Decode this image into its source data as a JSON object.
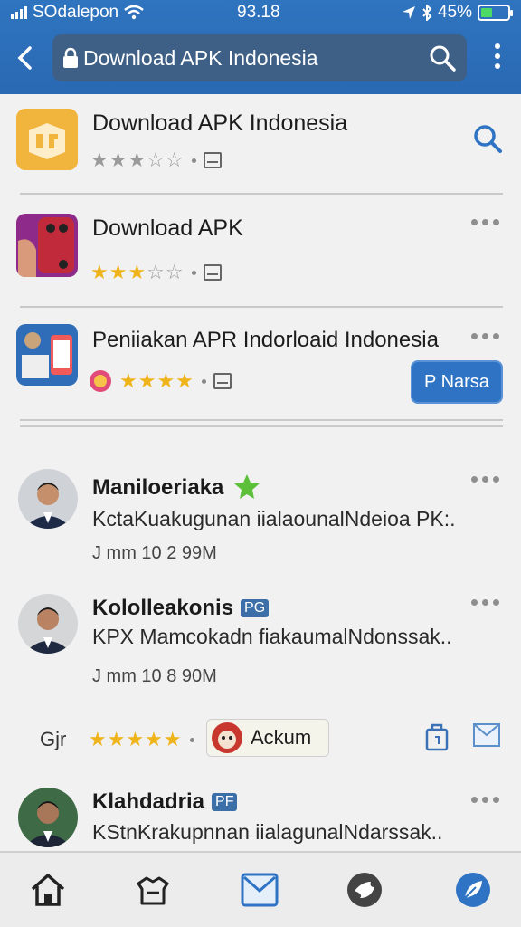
{
  "status": {
    "carrier": "SOdalepon",
    "time": "93.18",
    "battery": "45%"
  },
  "browser": {
    "url": "Download APK Indonesia"
  },
  "apps": [
    {
      "title": "Download APK Indonesia",
      "rating": 3,
      "rating_color": "grey"
    },
    {
      "title": "Download APK",
      "rating": 3,
      "rating_color": "gold"
    },
    {
      "title": "Peniiakan APR Indorloaid Indonesia",
      "rating": 4,
      "rating_color": "gold",
      "action_label": "P Narsa"
    }
  ],
  "posts": [
    {
      "name": "Maniloeriaka",
      "text": "KctaKuakugunan iialaounalNdeioa PK:.",
      "info": "J mm 10 2 99M"
    },
    {
      "name": "Kololleakonis",
      "badge": "PG",
      "text": "KPX Mamcokadn fiakaumalNdonssak..",
      "info": "J mm 10 8 90M"
    },
    {
      "name": "Klahdadria",
      "badge": "PF",
      "text": "KStnKrakupnnan iialagunalNdarssak.."
    }
  ],
  "action_row": {
    "prefix": "Gjr",
    "rating": 5,
    "chip_label": "Ackum"
  },
  "colors": {
    "accent": "#2f74c4",
    "star_gold": "#f0b41b",
    "header": "#2f74bf"
  },
  "icons": [
    "home-icon",
    "bag-icon",
    "mail-icon",
    "chat-bird-icon",
    "browser-leaf-icon"
  ]
}
